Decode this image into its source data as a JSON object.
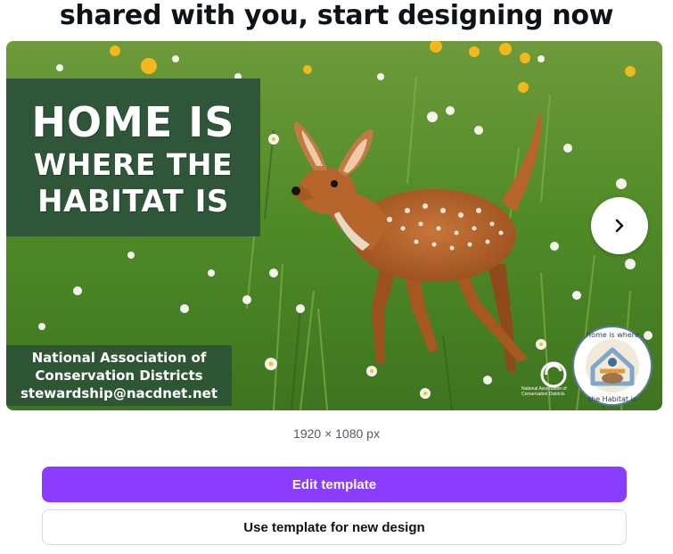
{
  "page": {
    "heading": "shared with you, start designing now"
  },
  "preview": {
    "headline": [
      "HOME IS",
      "WHERE THE",
      "HABITAT IS"
    ],
    "contact": [
      "National Association of",
      "Conservation Districts",
      "stewardship@nacdnet.net"
    ],
    "logo_caption": "National Association of Conservation Districts",
    "badge_text": "Home is where the Habitat is",
    "next_icon": "chevron-right-icon",
    "colors": {
      "headline_box": "#2f5638",
      "meadow": "#5f8f2c",
      "fawn": "#b5652a"
    }
  },
  "template": {
    "dimensions": "1920 × 1080 px"
  },
  "actions": {
    "edit_label": "Edit template",
    "use_label": "Use template for new design",
    "accent_color": "#8b3dff"
  }
}
